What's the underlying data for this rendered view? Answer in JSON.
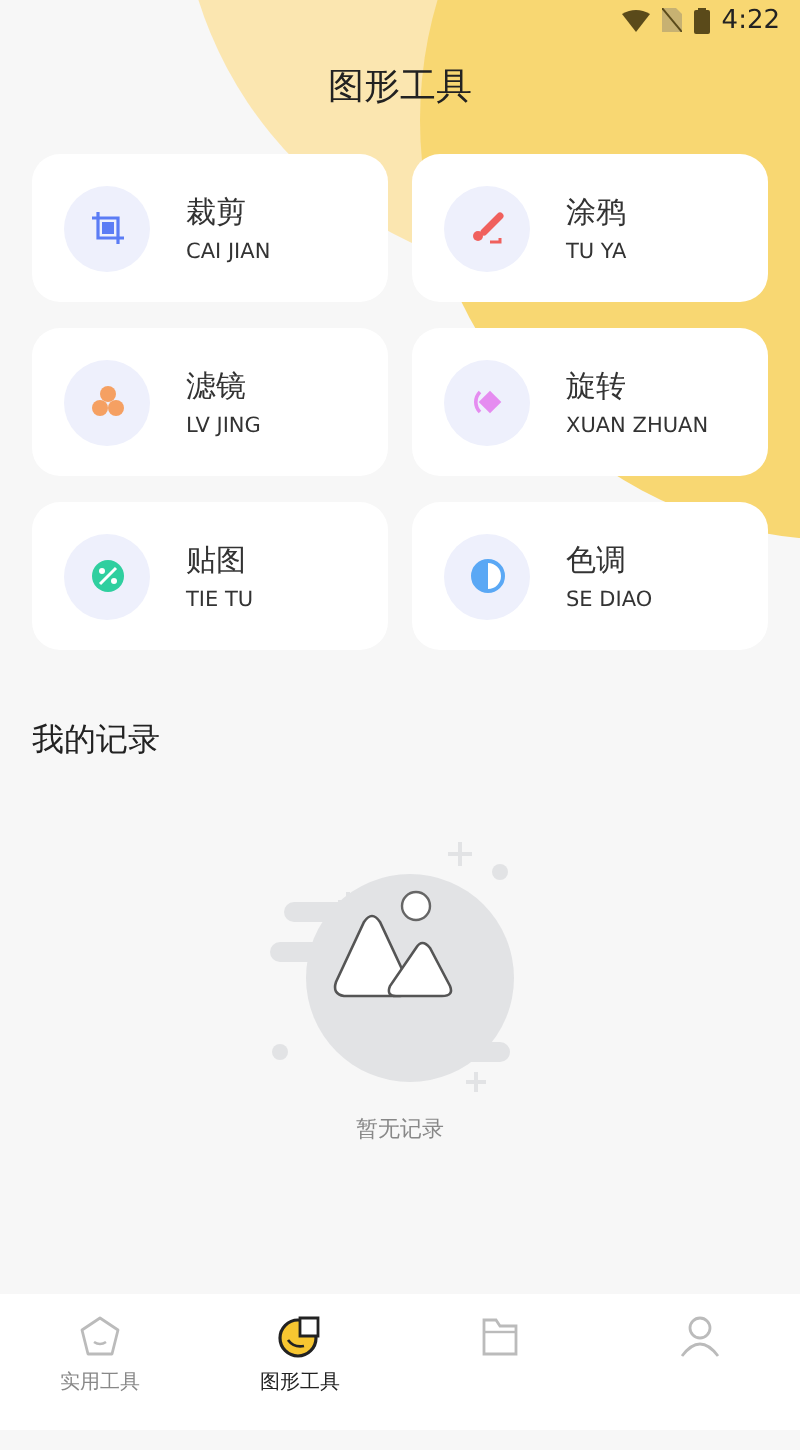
{
  "status_bar": {
    "time": "4:22"
  },
  "title": "图形工具",
  "tools": [
    {
      "kind": "crop",
      "name": "裁剪",
      "pinyin": "CAI JIAN",
      "color": "#5b7cf5"
    },
    {
      "kind": "brush",
      "name": "涂鸦",
      "pinyin": "TU YA",
      "color": "#f0605d"
    },
    {
      "kind": "filter",
      "name": "滤镜",
      "pinyin": "LV JING",
      "color": "#f5a062"
    },
    {
      "kind": "rotate",
      "name": "旋转",
      "pinyin": "XUAN ZHUAN",
      "color": "#e58cf0"
    },
    {
      "kind": "sticker",
      "name": "贴图",
      "pinyin": "TIE TU",
      "color": "#2fcf9f"
    },
    {
      "kind": "tone",
      "name": "色调",
      "pinyin": "SE DIAO",
      "color": "#5aa8f5"
    }
  ],
  "records": {
    "title": "我的记录",
    "empty_text": "暂无记录"
  },
  "tabs": [
    {
      "kind": "home",
      "label": "实用工具",
      "selected": false
    },
    {
      "kind": "chart",
      "label": "图形工具",
      "selected": true
    },
    {
      "kind": "folder",
      "selected": false
    },
    {
      "kind": "user",
      "selected": false
    }
  ]
}
